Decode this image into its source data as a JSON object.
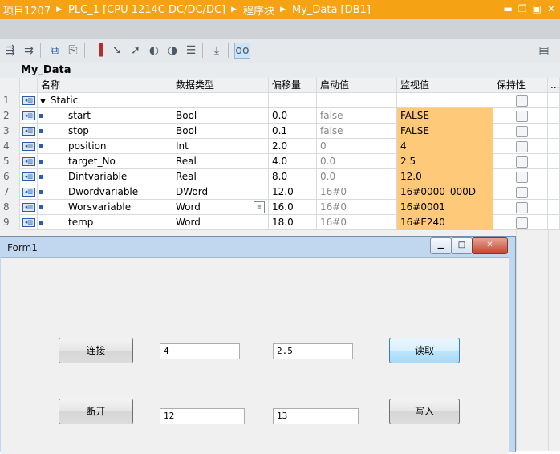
{
  "titlebar": {
    "crumbs": [
      "项目1207",
      "PLC_1 [CPU 1214C DC/DC/DC]",
      "程序块",
      "My_Data [DB1]"
    ],
    "window_controls": [
      "minimize-icon",
      "restore-icon",
      "maximize-icon",
      "close-icon"
    ]
  },
  "toolbar": {
    "icons": [
      "insert-row-icon",
      "add-row-icon",
      "snapshot-icon",
      "copy-snapshot-icon",
      "load-start-values-icon",
      "expand-icon",
      "collapse-icon",
      "step-back-icon",
      "step-forward-icon",
      "list-icon",
      "keep-actual-icon",
      "monitor-glasses-icon",
      "overview-icon"
    ]
  },
  "block": {
    "name": "My_Data"
  },
  "table": {
    "headers": {
      "name": "名称",
      "type": "数据类型",
      "offset": "偏移量",
      "start": "启动值",
      "monitor": "监视值",
      "retain": "保持性",
      "more": "..."
    },
    "static_row": {
      "num": "1",
      "name": "Static"
    },
    "rows": [
      {
        "num": "2",
        "name": "start",
        "type": "Bool",
        "offset": "0.0",
        "start": "false",
        "monitor": "FALSE"
      },
      {
        "num": "3",
        "name": "stop",
        "type": "Bool",
        "offset": "0.1",
        "start": "false",
        "monitor": "FALSE"
      },
      {
        "num": "4",
        "name": "position",
        "type": "Int",
        "offset": "2.0",
        "start": "0",
        "monitor": "4"
      },
      {
        "num": "5",
        "name": "target_No",
        "type": "Real",
        "offset": "4.0",
        "start": "0.0",
        "monitor": "2.5"
      },
      {
        "num": "6",
        "name": "Dintvariable",
        "type": "Real",
        "offset": "8.0",
        "start": "0.0",
        "monitor": "12.0"
      },
      {
        "num": "7",
        "name": "Dwordvariable",
        "type": "DWord",
        "offset": "12.0",
        "start": "16#0",
        "monitor": "16#0000_000D"
      },
      {
        "num": "8",
        "name": "Worsvariable",
        "type": "Word",
        "offset": "16.0",
        "start": "16#0",
        "monitor": "16#0001"
      },
      {
        "num": "9",
        "name": "temp",
        "type": "Word",
        "offset": "18.0",
        "start": "16#0",
        "monitor": "16#E240"
      }
    ]
  },
  "form": {
    "title": "Form1",
    "buttons": {
      "connect": "连接",
      "disconnect": "断开",
      "read": "读取",
      "write": "写入"
    },
    "textboxes": {
      "tb1": "4",
      "tb2": "2.5",
      "tb3": "12",
      "tb4": "13"
    }
  },
  "colors": {
    "titlebar": "#f5a314",
    "monitor_cell": "#ffc97a",
    "form_frame": "#c1d7ef"
  }
}
